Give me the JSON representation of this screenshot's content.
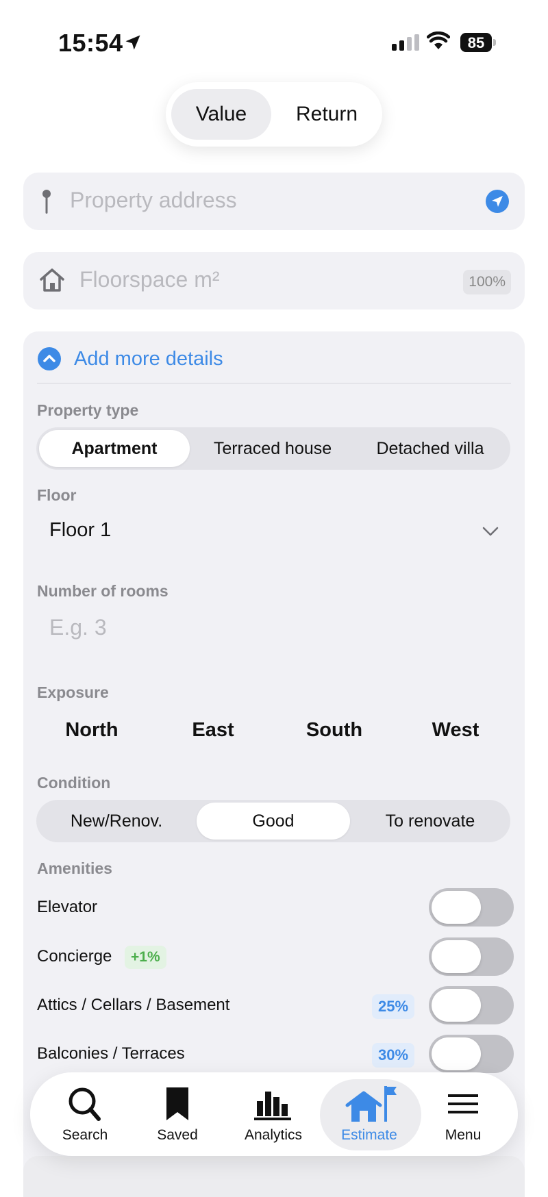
{
  "status_bar": {
    "time": "15:54",
    "battery": "85"
  },
  "mode_switch": {
    "options": [
      "Value",
      "Return"
    ],
    "selected": "Value"
  },
  "address": {
    "placeholder": "Property address"
  },
  "floorspace": {
    "placeholder": "Floorspace m²",
    "badge": "100%"
  },
  "details": {
    "toggle_label": "Add more details",
    "property_type": {
      "label": "Property type",
      "options": [
        "Apartment",
        "Terraced house",
        "Detached villa"
      ],
      "selected": "Apartment"
    },
    "floor": {
      "label": "Floor",
      "value": "Floor 1"
    },
    "rooms": {
      "label": "Number of rooms",
      "placeholder": "E.g. 3"
    },
    "exposure": {
      "label": "Exposure",
      "options": [
        "North",
        "East",
        "South",
        "West"
      ]
    },
    "condition": {
      "label": "Condition",
      "options": [
        "New/Renov.",
        "Good",
        "To renovate"
      ],
      "selected": "Good"
    },
    "amenities": {
      "label": "Amenities",
      "items": [
        {
          "name": "Elevator",
          "badge": "",
          "on": false
        },
        {
          "name": "Concierge",
          "badge": "+1%",
          "on": false
        },
        {
          "name": "Attics / Cellars / Basement",
          "badge": "25%",
          "on": false
        },
        {
          "name": "Balconies / Terraces",
          "badge": "30%",
          "on": false
        }
      ]
    }
  },
  "tab_bar": {
    "items": [
      {
        "label": "Search",
        "icon": "search-icon"
      },
      {
        "label": "Saved",
        "icon": "bookmark-icon"
      },
      {
        "label": "Analytics",
        "icon": "bar-chart-icon"
      },
      {
        "label": "Estimate",
        "icon": "house-flag-icon"
      },
      {
        "label": "Menu",
        "icon": "menu-icon"
      }
    ],
    "active": "Estimate"
  },
  "colors": {
    "accent": "#3d8ae6",
    "green": "#4cae4c",
    "card": "#f1f1f5"
  }
}
